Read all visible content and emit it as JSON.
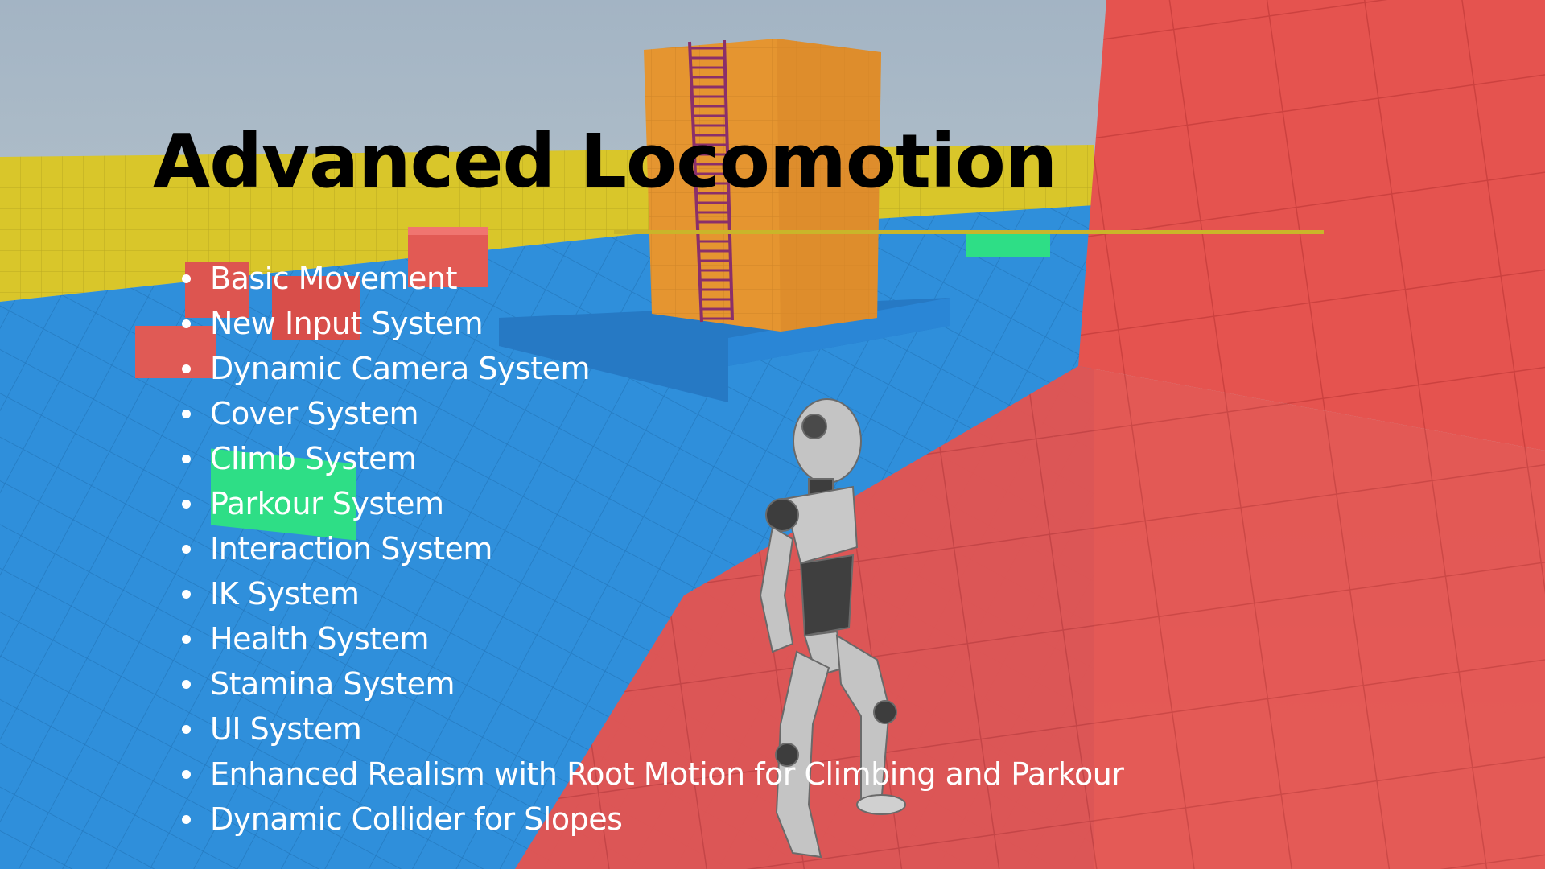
{
  "slide": {
    "title": "Advanced Locomotion",
    "colors": {
      "title": "#000000",
      "text": "#ffffff",
      "rule": "#c9b52a",
      "sky_top": "#a3b4c4",
      "sky_bottom": "#d2dad8",
      "wall_yellow": "#d9c62a",
      "floor_blue": "#2f8fdb",
      "wall_red": "#e5534f",
      "tower_orange": "#e59530",
      "ladder_purple": "#8a2f6a",
      "block_green": "#2ede86",
      "robot_gray": "#b8b8b8"
    },
    "features": [
      "Basic Movement",
      "New Input System",
      "Dynamic Camera System",
      "Cover System",
      "Climb System",
      "Parkour System",
      "Interaction System",
      "IK System",
      "Health System",
      "Stamina System",
      "UI System",
      "Enhanced Realism with Root Motion for Climbing and Parkour",
      "Dynamic Collider for Slopes"
    ]
  }
}
